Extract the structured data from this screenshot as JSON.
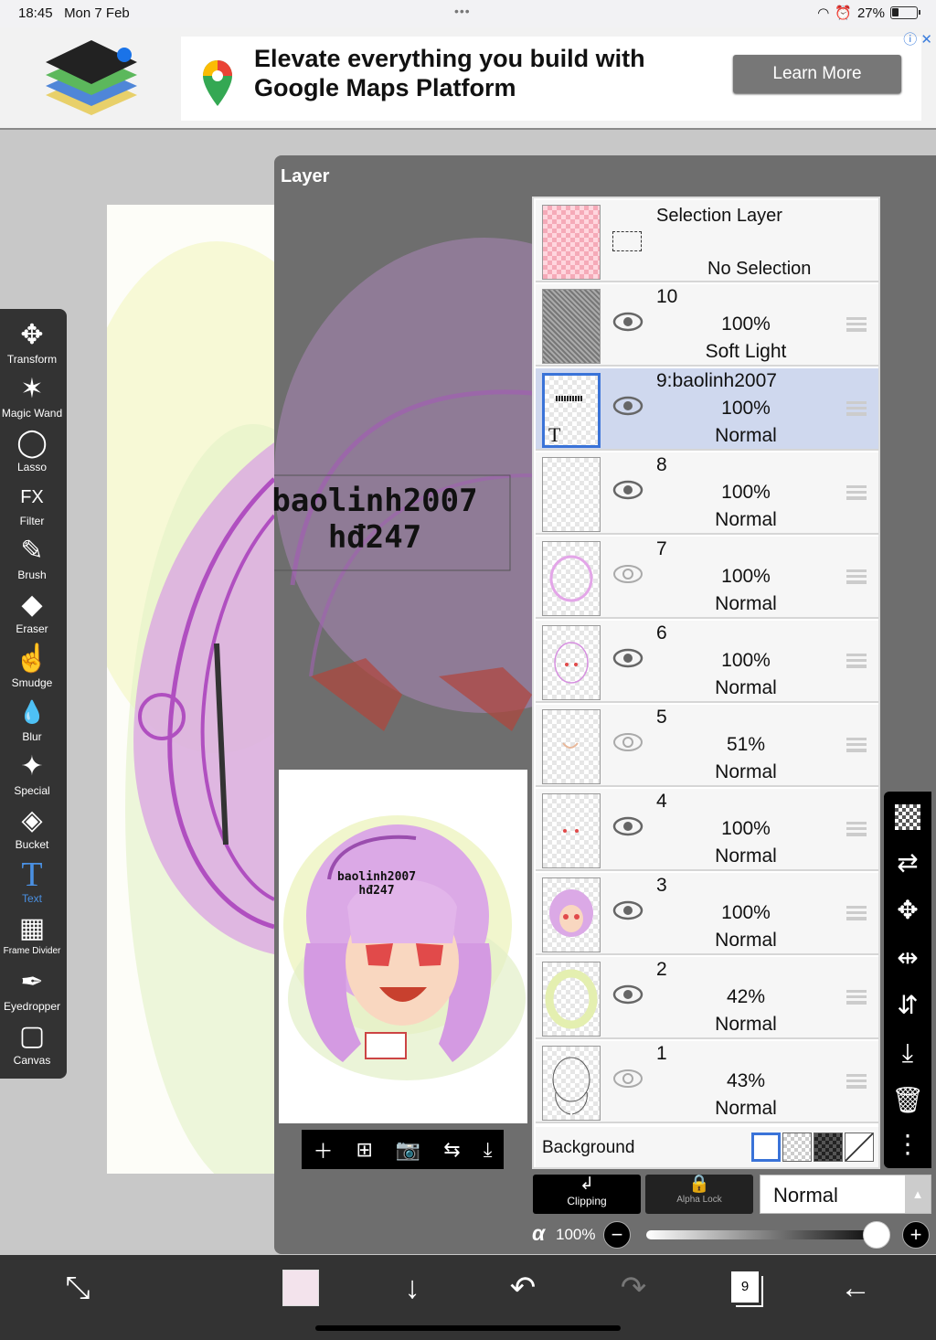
{
  "status_bar": {
    "time": "18:45",
    "date": "Mon 7 Feb",
    "battery": "27%"
  },
  "ad": {
    "title": "Elevate everything you build with Google Maps Platform",
    "button": "Learn More"
  },
  "tools": [
    {
      "label": "Transform",
      "icon": "✥"
    },
    {
      "label": "Magic Wand",
      "icon": "✶"
    },
    {
      "label": "Lasso",
      "icon": "◯"
    },
    {
      "label": "Filter",
      "icon": "FX"
    },
    {
      "label": "Brush",
      "icon": "✎"
    },
    {
      "label": "Eraser",
      "icon": "◆"
    },
    {
      "label": "Smudge",
      "icon": "☝"
    },
    {
      "label": "Blur",
      "icon": "💧"
    },
    {
      "label": "Special",
      "icon": "✦"
    },
    {
      "label": "Bucket",
      "icon": "◈"
    },
    {
      "label": "Text",
      "icon": "T"
    },
    {
      "label": "Frame Divider",
      "icon": "▦"
    },
    {
      "label": "Eyedropper",
      "icon": "✒"
    },
    {
      "label": "Canvas",
      "icon": "▢"
    }
  ],
  "panel": {
    "title": "Layer"
  },
  "canvas_text": {
    "line1": "baolinh2007",
    "line2": "hđ247"
  },
  "selection_layer": {
    "title": "Selection Layer",
    "status": "No Selection"
  },
  "layers": [
    {
      "name": "10",
      "opacity": "100%",
      "blend": "Soft Light",
      "selected": false
    },
    {
      "name": "9:baolinh2007",
      "opacity": "100%",
      "blend": "Normal",
      "selected": true
    },
    {
      "name": "8",
      "opacity": "100%",
      "blend": "Normal",
      "selected": false
    },
    {
      "name": "7",
      "opacity": "100%",
      "blend": "Normal",
      "selected": false
    },
    {
      "name": "6",
      "opacity": "100%",
      "blend": "Normal",
      "selected": false
    },
    {
      "name": "5",
      "opacity": "51%",
      "blend": "Normal",
      "selected": false
    },
    {
      "name": "4",
      "opacity": "100%",
      "blend": "Normal",
      "selected": false
    },
    {
      "name": "3",
      "opacity": "100%",
      "blend": "Normal",
      "selected": false
    },
    {
      "name": "2",
      "opacity": "42%",
      "blend": "Normal",
      "selected": false
    },
    {
      "name": "1",
      "opacity": "43%",
      "blend": "Normal",
      "selected": false
    }
  ],
  "background_label": "Background",
  "controls": {
    "clipping": "Clipping",
    "alpha_lock": "Alpha Lock",
    "blend_mode": "Normal",
    "alpha_symbol": "α",
    "alpha_value": "100%",
    "alpha_level": 1.0
  },
  "layer_count": "9"
}
